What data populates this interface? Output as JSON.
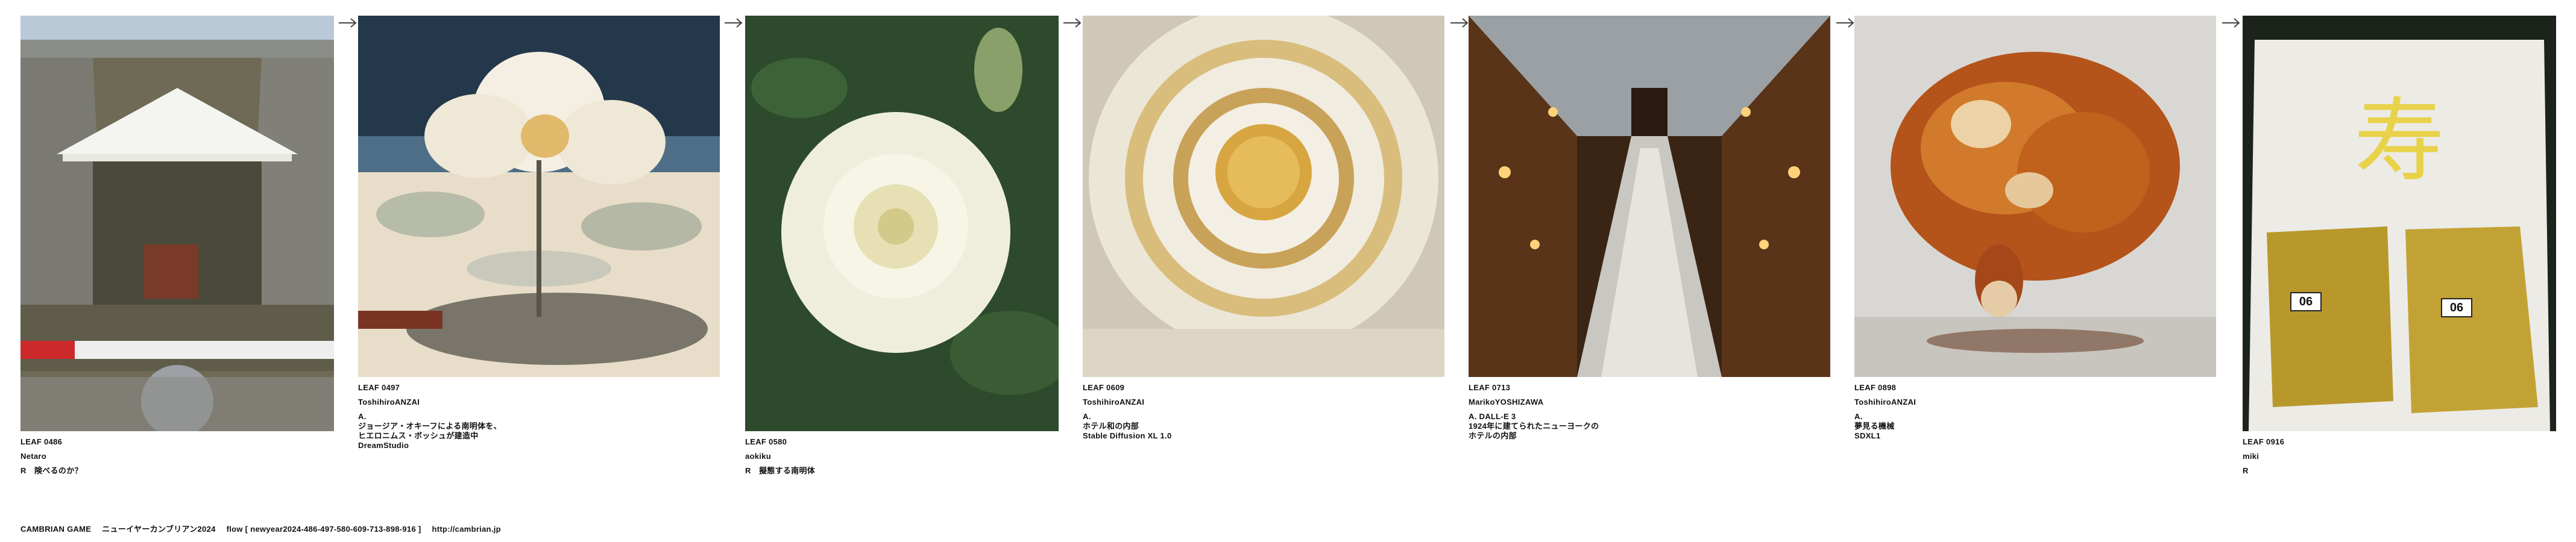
{
  "leaves": [
    {
      "number": "LEAF 0486",
      "author": "Netaro",
      "lines": [
        "R　険べるのか？"
      ],
      "image": "concrete-dock-with-white-tent"
    },
    {
      "number": "LEAF 0497",
      "author": "ToshihiroANZAI",
      "lines": [
        "A.",
        "ジョージア・オキーフによる南明体を、",
        "ヒエロニムス・ボッシュが建造中",
        "DreamStudio"
      ],
      "image": "surreal-white-flower-structure"
    },
    {
      "number": "LEAF 0580",
      "author": "aokiku",
      "lines": [
        "R　擬態する南明体"
      ],
      "image": "white-rose"
    },
    {
      "number": "LEAF 0609",
      "author": "ToshihiroANZAI",
      "lines": [
        "A.",
        "ホテル和の内部",
        "Stable Diffusion XL 1.0"
      ],
      "image": "paper-spiral-interior"
    },
    {
      "number": "LEAF 0713",
      "author": "MarikoYOSHIZAWA",
      "lines": [
        "A. DALL-E 3",
        "1924年に建てられたニューヨークの",
        "ホテルの内部"
      ],
      "image": "ornate-staircase-atrium"
    },
    {
      "number": "LEAF 0898",
      "author": "ToshihiroANZAI",
      "lines": [
        "A.",
        "夢見る機械",
        "SDXL1"
      ],
      "image": "copper-brain-machine"
    },
    {
      "number": "LEAF 0916",
      "author": "miki",
      "lines": [
        "R"
      ],
      "image": "gold-packets-in-bag",
      "tags": [
        "06",
        "06"
      ],
      "sign": "寿"
    }
  ],
  "footer": {
    "brand": "CAMBRIAN GAME",
    "title": "ニューイヤーカンブリアン2024",
    "flow": "flow [ newyear2024-486-497-580-609-713-898-916 ]",
    "url": "http://cambrian.jp"
  },
  "colors": {
    "text": "#111111",
    "arrow": "#444444",
    "background": "#ffffff"
  }
}
